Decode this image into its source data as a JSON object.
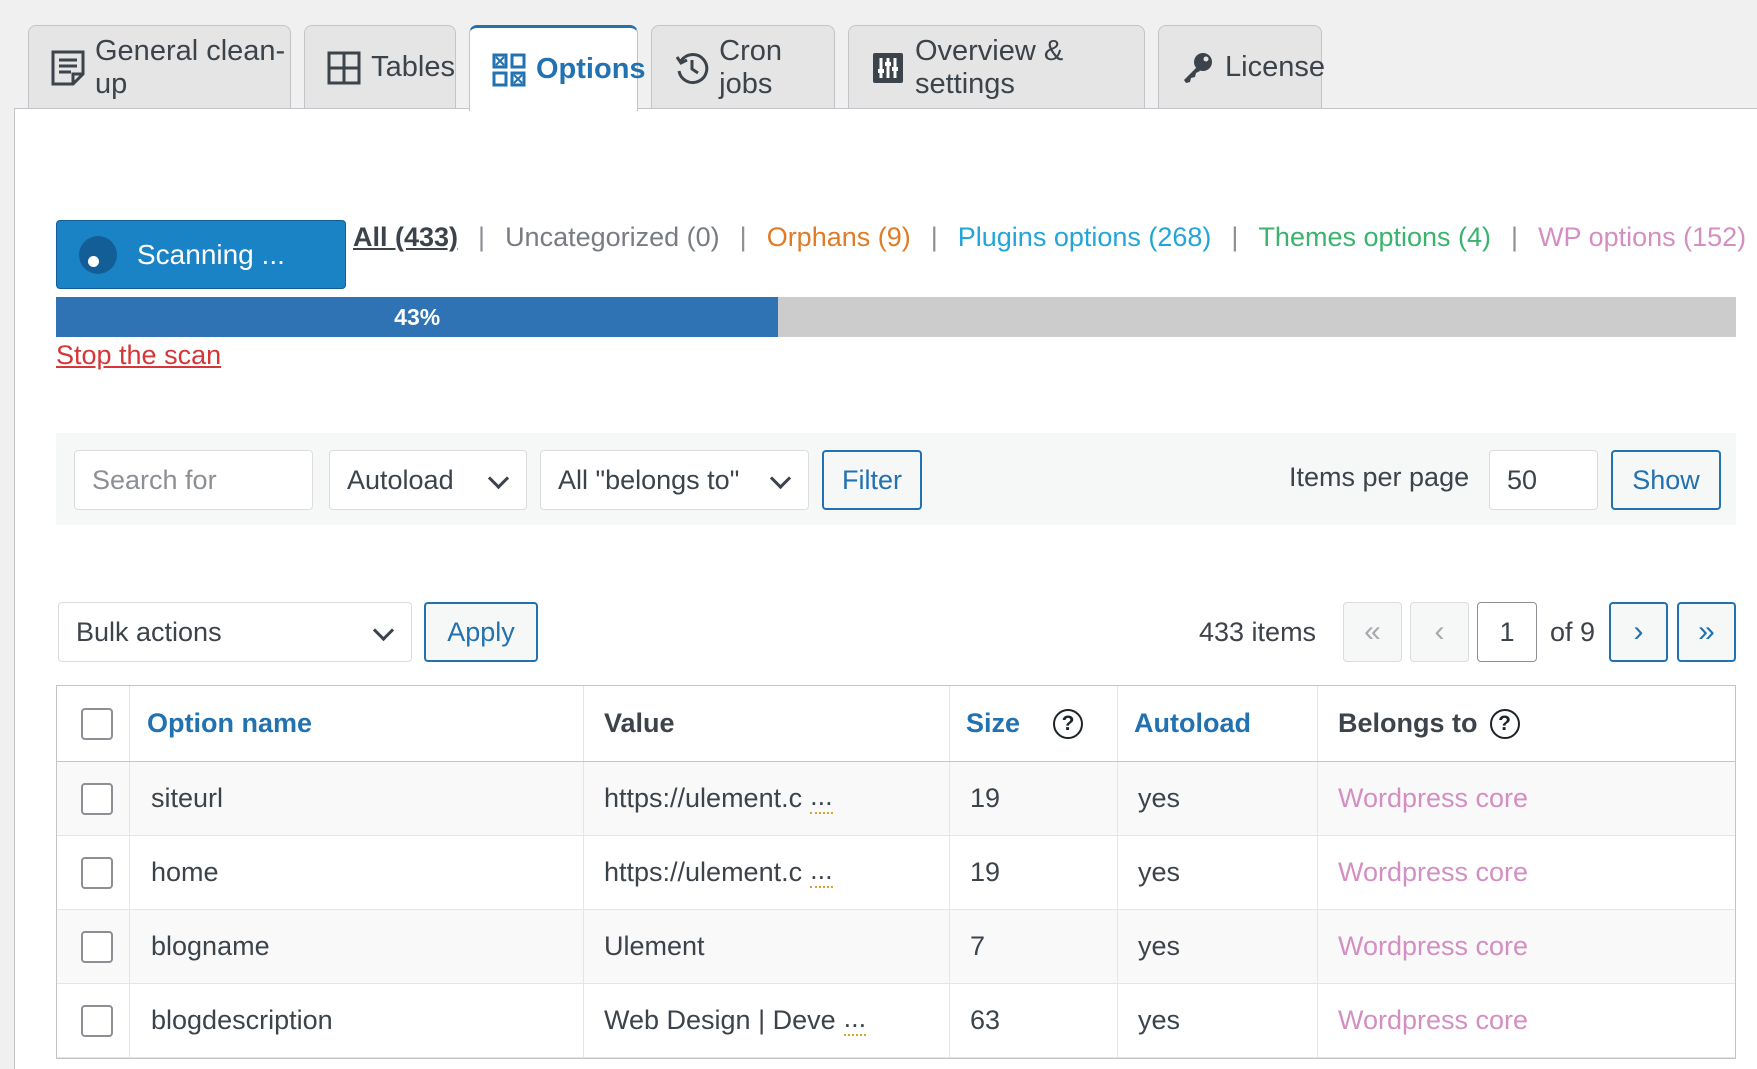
{
  "tabs": [
    {
      "label": "General clean-up",
      "icon": "document-icon"
    },
    {
      "label": "Tables",
      "icon": "grid-icon"
    },
    {
      "label": "Options",
      "icon": "options-icon"
    },
    {
      "label": "Cron jobs",
      "icon": "history-icon"
    },
    {
      "label": "Overview & settings",
      "icon": "sliders-icon"
    },
    {
      "label": "License",
      "icon": "key-icon"
    }
  ],
  "scan": {
    "button_label": "Scanning ...",
    "progress_fraction": 0.43,
    "progress_label": "43%",
    "stop_label": "Stop the scan"
  },
  "views": [
    {
      "label": "All (433)"
    },
    {
      "label": "Uncategorized (0)"
    },
    {
      "label": "Orphans (9)"
    },
    {
      "label": "Plugins options (268)"
    },
    {
      "label": "Themes options (4)"
    },
    {
      "label": "WP options (152)"
    }
  ],
  "colors": {
    "accent": "#2271b1",
    "orphans": "#e07b26",
    "plugins": "#22a5d8",
    "themes": "#3ab36f",
    "wp": "#d48fc2",
    "stop": "#d63638"
  },
  "filters": {
    "search_placeholder": "Search for",
    "autoload_select": "Autoload",
    "belongs_select": "All \"belongs to\"",
    "filter_button": "Filter",
    "items_per_page_label": "Items per page",
    "items_per_page_value": "50",
    "show_button": "Show"
  },
  "tablenav": {
    "bulk_actions": "Bulk actions",
    "apply_button": "Apply",
    "items_count": "433 items",
    "first_page": "«",
    "prev_page": "‹",
    "current_page": "1",
    "of_pages": "of 9",
    "next_page": "›",
    "last_page": "»"
  },
  "table": {
    "columns": {
      "option_name": "Option name",
      "value": "Value",
      "size": "Size",
      "autoload": "Autoload",
      "belongs_to": "Belongs to"
    },
    "rows": [
      {
        "name": "siteurl",
        "value": "https://ulement.c",
        "size": "19",
        "autoload": "yes",
        "belongs": "Wordpress core"
      },
      {
        "name": "home",
        "value": "https://ulement.c",
        "size": "19",
        "autoload": "yes",
        "belongs": "Wordpress core"
      },
      {
        "name": "blogname",
        "value": "Ulement",
        "size": "7",
        "autoload": "yes",
        "belongs": "Wordpress core"
      },
      {
        "name": "blogdescription",
        "value": "Web Design | Deve",
        "size": "63",
        "autoload": "yes",
        "belongs": "Wordpress core"
      }
    ],
    "more_marker": "...",
    "help_glyph": "?"
  }
}
